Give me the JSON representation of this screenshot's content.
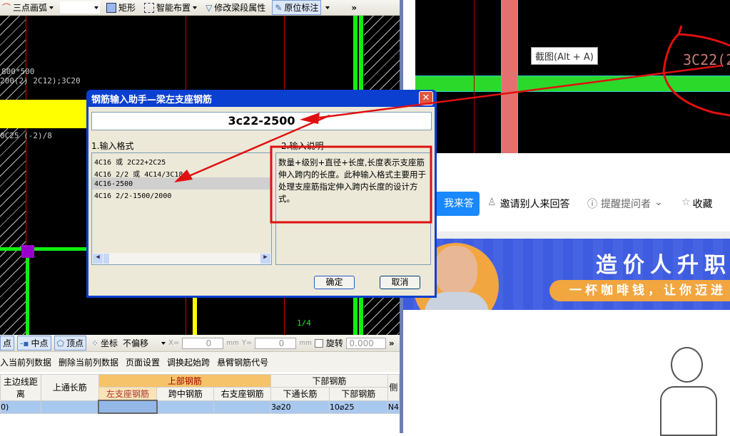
{
  "toolbar": {
    "arc": "三点画弧",
    "rect": "矩形",
    "smart_layout": "智能布置",
    "modify_beam": "修改梁段属性",
    "inplace_label": "原位标注",
    "more": "»"
  },
  "cad": {
    "label1": "800*500",
    "label2": "200(2) 2C12);3C20",
    "label3": "0C25 (-2)/8",
    "grid_label": "1/4"
  },
  "dialog": {
    "title": "钢筋输入助手—梁左支座钢筋",
    "input_value": "3c22-2500",
    "format_label": "1.输入格式",
    "formats": [
      "4C16 或 2C22+2C25",
      "4C16 2/2 或 4C14/3C18",
      "4C16-2500",
      "4C16 2/2-1500/2000"
    ],
    "selected_format": 2,
    "desc_label": "2.输入说明",
    "description": "数量+级别+直径+长度,长度表示支座筋伸入跨内的长度。此种输入格式主要用于处理支座筋指定伸入跨内长度的设计方式。",
    "ok": "确定",
    "cancel": "取消"
  },
  "snapbar": {
    "point": "点",
    "midpoint": "中点",
    "vertex": "顶点",
    "coord": "坐标",
    "offset_mode": "不偏移",
    "x_label": "X=",
    "x_value": "0",
    "y_label": "Y=",
    "y_value": "0",
    "unit": "mm",
    "rotate": "旋转",
    "rotate_value": "0.000",
    "more": "»"
  },
  "tablebar": [
    "入当前列数据",
    "删除当前列数据",
    "页面设置",
    "调换起始跨",
    "悬臂钢筋代号"
  ],
  "table": {
    "h_edge": "主边线距离",
    "h_top_through": "上通长筋",
    "h_top": "上部钢筋",
    "h_bottom": "下部钢筋",
    "h_left": "左支座钢筋",
    "h_mid": "跨中钢筋",
    "h_right": "右支座钢筋",
    "h_bot_through": "下通长筋",
    "h_bot_bar": "下部钢筋",
    "h_side": "侧",
    "row": {
      "edge": "0)",
      "top_through": "",
      "left": "",
      "mid": "",
      "right": "",
      "bot_through": "3⌀20",
      "bot_bar": "10⌀25",
      "side": "N4"
    }
  },
  "screenshot": {
    "tooltip": "截图(Alt + A)",
    "annot": "3C22(2"
  },
  "web": {
    "answer": "我来答",
    "invite": "邀请别人来回答",
    "remind": "提醒提问者",
    "favorite": "收藏",
    "banner_title": "造价人升职",
    "banner_sub": "一杯咖啡钱，让你迈进"
  },
  "colors": {
    "accent": "#1a88ff",
    "annotation": "#ff1a1a",
    "beam": "#2bd92b",
    "banner": "#3e5ce0"
  }
}
